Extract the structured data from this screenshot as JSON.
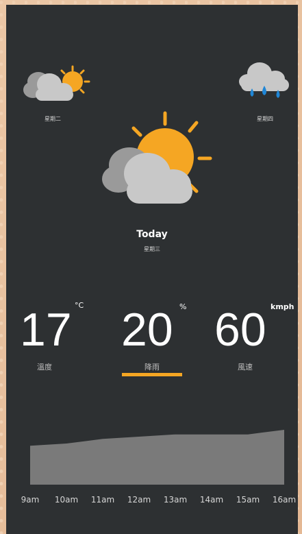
{
  "forecast": {
    "left_day": {
      "label": "星期二",
      "icon": "partly-cloudy-icon"
    },
    "right_day": {
      "label": "星期四",
      "icon": "rain-cloud-icon"
    }
  },
  "today": {
    "title": "Today",
    "weekday": "星期三",
    "icon": "partly-cloudy-large-icon"
  },
  "stats": [
    {
      "value": "17",
      "unit": "°C",
      "label": "溫度"
    },
    {
      "value": "20",
      "unit": "%",
      "label": "降雨"
    },
    {
      "value": "60",
      "unit": "kmph",
      "label": "風速"
    }
  ],
  "selected_stat_index": 1,
  "colors": {
    "background": "#2d3032",
    "accent": "#f5a623",
    "cloud": "#c8c8c8",
    "rain": "#1f86d6",
    "chart_fill": "#7a7a7a"
  },
  "chart_data": {
    "type": "area",
    "categories": [
      "9am",
      "10am",
      "11am",
      "12am",
      "13am",
      "14am",
      "15am",
      "16am"
    ],
    "values": [
      17,
      18,
      20,
      21,
      22,
      22,
      22,
      24
    ],
    "ylim": [
      0,
      24
    ]
  }
}
